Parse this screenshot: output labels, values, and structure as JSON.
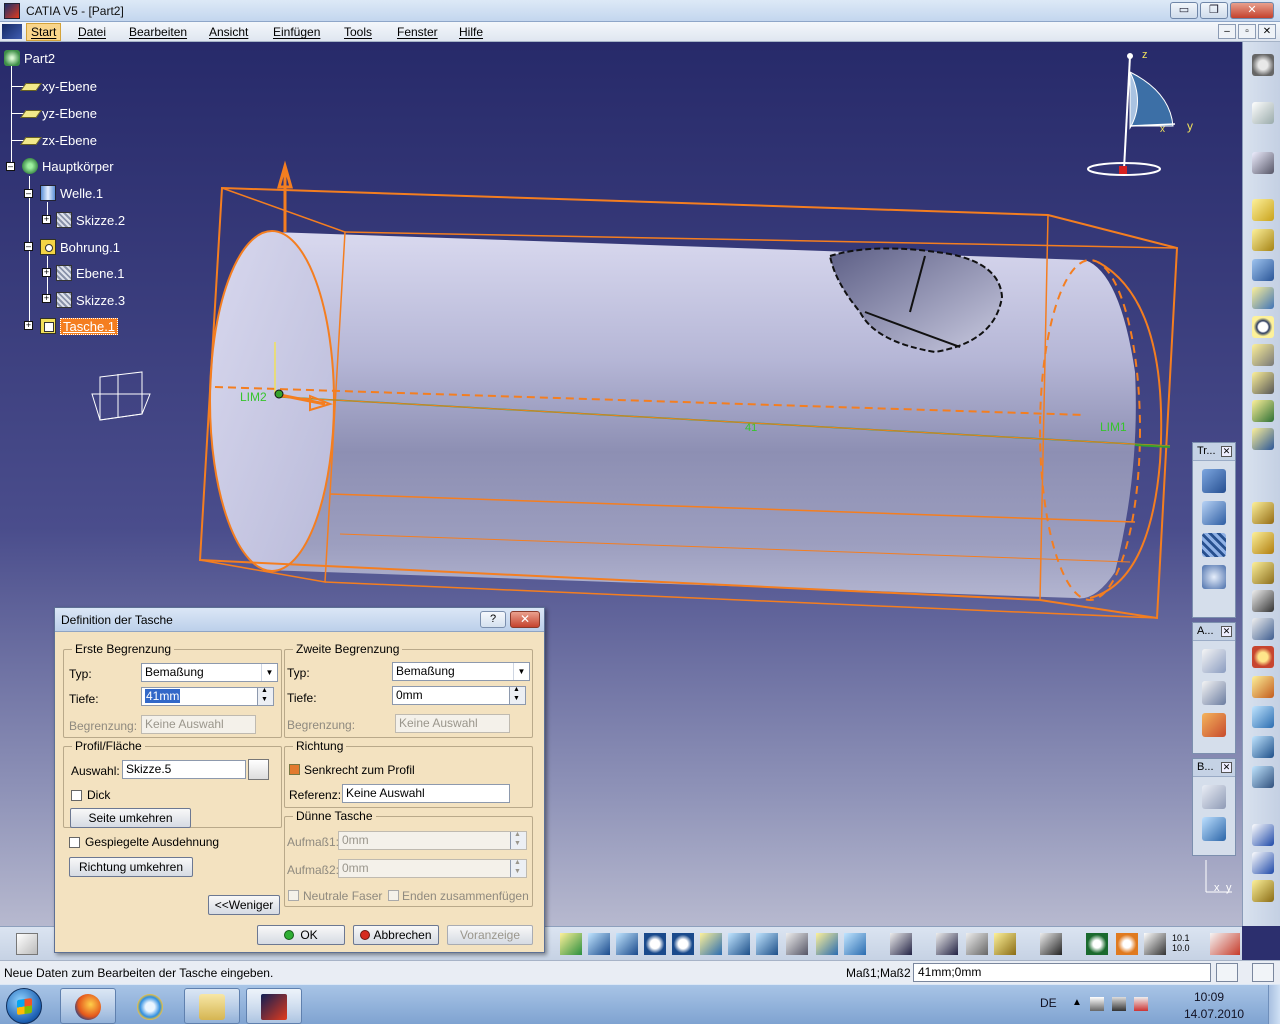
{
  "window": {
    "title": "CATIA V5 - [Part2]",
    "min": "▭",
    "max": "❐",
    "close": "✕"
  },
  "menu": {
    "items": [
      "Start",
      "Datei",
      "Bearbeiten",
      "Ansicht",
      "Einfügen",
      "Tools",
      "Fenster",
      "Hilfe"
    ],
    "active": "Start"
  },
  "doc_buttons": [
    "–",
    "▫",
    "✕"
  ],
  "tree": {
    "root": "Part2",
    "xy": "xy-Ebene",
    "yz": "yz-Ebene",
    "zx": "zx-Ebene",
    "body": "Hauptkörper",
    "shaft": "Welle.1",
    "sketch2": "Skizze.2",
    "hole": "Bohrung.1",
    "plane1": "Ebene.1",
    "sketch3": "Skizze.3",
    "pocket": "Tasche.1"
  },
  "viewport": {
    "lim1": "LIM1",
    "lim2": "LIM2",
    "dim": "41",
    "axis_z": "z",
    "axis_y": "y",
    "axis_x": "x"
  },
  "float_toolbars": {
    "tr": "Tr...",
    "a": "A...",
    "b": "B...",
    "close": "✕"
  },
  "compass_axes": {
    "y": "y",
    "x": "x"
  },
  "dialog": {
    "title": "Definition der Tasche",
    "help": "?",
    "close": "✕",
    "first": {
      "group": "Erste Begrenzung",
      "type_label": "Typ:",
      "type_value": "Bemaßung",
      "depth_label": "Tiefe:",
      "depth_value": "41mm",
      "limit_label": "Begrenzung:",
      "limit_value": "Keine Auswahl"
    },
    "second": {
      "group": "Zweite Begrenzung",
      "type_label": "Typ:",
      "type_value": "Bemaßung",
      "depth_label": "Tiefe:",
      "depth_value": "0mm",
      "limit_label": "Begrenzung:",
      "limit_value": "Keine Auswahl"
    },
    "profile": {
      "group": "Profil/Fläche",
      "selection_label": "Auswahl:",
      "selection_value": "Skizze.5",
      "thick_label": "Dick",
      "reverse_side": "Seite umkehren"
    },
    "direction": {
      "group": "Richtung",
      "normal_label": "Senkrecht zum Profil",
      "reference_label": "Referenz:",
      "reference_value": "Keine Auswahl"
    },
    "thin": {
      "group": "Dünne Tasche",
      "thick1_label": "Aufmaß1:",
      "thick1_value": "0mm",
      "thick2_label": "Aufmaß2:",
      "thick2_value": "0mm",
      "neutral_label": "Neutrale Faser",
      "merge_label": "Enden zusammenfügen"
    },
    "mirrored_label": "Gespiegelte Ausdehnung",
    "reverse_dir": "Richtung umkehren",
    "less": "<<Weniger",
    "ok": "OK",
    "cancel": "Abbrechen",
    "preview": "Voranzeige"
  },
  "bottom_toolbar": {
    "angle_text": "10.1\n10.0"
  },
  "status": {
    "message": "Neue Daten zum Bearbeiten der Tasche eingeben.",
    "measure_label": "Maß1;Maß2",
    "command_value": "41mm;0mm"
  },
  "taskbar": {
    "lang": "DE",
    "time": "10:09",
    "date": "14.07.2010"
  },
  "colors": {
    "accent_orange": "#f47e20",
    "viewport_top": "#272a6a",
    "dialog_bg": "#f3e2c0"
  }
}
